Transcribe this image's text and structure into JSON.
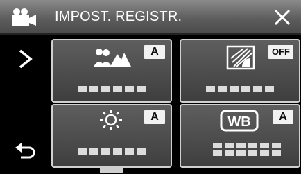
{
  "header": {
    "title": "IMPOST. REGISTR.",
    "mode_icon": "video-camera-icon",
    "close_icon": "close-icon"
  },
  "sidebar": {
    "next_icon": "chevron-right-icon",
    "back_icon": "return-arrow-icon"
  },
  "tiles": [
    {
      "icon": "scene-select-icon",
      "badge": "A"
    },
    {
      "icon": "backlight-compensation-icon",
      "badge": "OFF"
    },
    {
      "icon": "brightness-icon",
      "badge": "A"
    },
    {
      "icon": "white-balance-icon",
      "icon_text": "WB",
      "badge": "A"
    }
  ],
  "colors": {
    "header_top": "#8a8a8a",
    "tile_bg": "#4a4a4a",
    "tile_border": "#d0d0d0",
    "text": "#ffffff"
  }
}
